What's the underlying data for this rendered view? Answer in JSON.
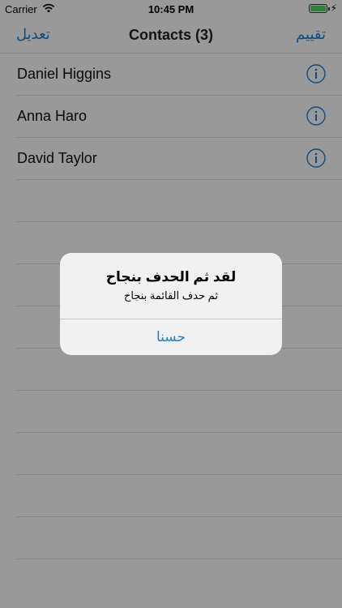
{
  "status": {
    "carrier": "Carrier",
    "time": "10:45 PM",
    "bolt": "⚡"
  },
  "nav": {
    "left": "تعديل",
    "title": "Contacts (3)",
    "right": "تقييم"
  },
  "contacts": [
    {
      "name": "Daniel Higgins"
    },
    {
      "name": "Anna Haro"
    },
    {
      "name": "David Taylor"
    }
  ],
  "alert": {
    "title": "لقد ثم الحدف بنجاح",
    "message": "ثم حدف القائمة بنجاح",
    "button": "حسنا"
  },
  "colors": {
    "accent": "#1b7fd6",
    "overlay": "rgba(0,0,0,0.40)",
    "battery": "#4cd964"
  },
  "icons": {
    "wifi": "wifi-icon",
    "info": "info-icon",
    "battery": "battery-icon",
    "bolt": "charging-bolt-icon"
  }
}
